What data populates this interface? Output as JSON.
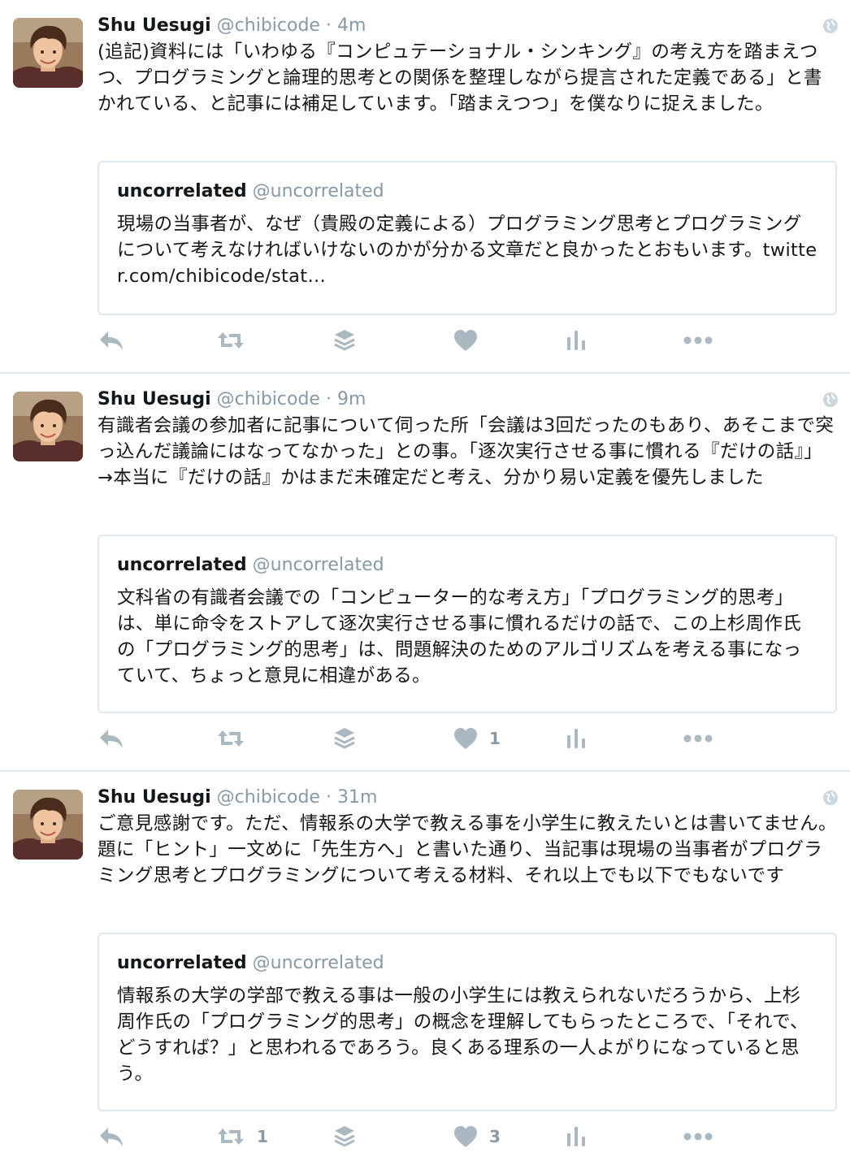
{
  "tweets": [
    {
      "name": "Shu Uesugi",
      "handle": "@chibicode",
      "dot": "·",
      "time": "4m",
      "text": "(追記)資料には「いわゆる『コンピュテーショナル・シンキング』の考え方を踏まえつつ、プログラミングと論理的思考との関係を整理しながら提言された定義である」と書かれている、と記事には補足しています。「踏まえつつ」を僕なりに捉えました。",
      "quote": {
        "name": "uncorrelated",
        "handle": "@uncorrelated",
        "text": "現場の当事者が、なぜ（貴殿の定義による）プログラミング思考とプログラミングについて考えなければいけないのかが分かる文章だと良かったとおもいます。twitter.com/chibicode/stat…"
      },
      "counts": {
        "retweets": "",
        "likes": ""
      }
    },
    {
      "name": "Shu Uesugi",
      "handle": "@chibicode",
      "dot": "·",
      "time": "9m",
      "text": "有識者会議の参加者に記事について伺った所「会議は3回だったのもあり、あそこまで突っ込んだ議論にはなってなかった」との事。「逐次実行させる事に慣れる『だけの話』」→本当に『だけの話』かはまだ未確定だと考え、分かり易い定義を優先しました",
      "quote": {
        "name": "uncorrelated",
        "handle": "@uncorrelated",
        "text": "文科省の有識者会議での「コンピューター的な考え方」「プログラミング的思考」は、単に命令をストアして逐次実行させる事に慣れるだけの話で、この上杉周作氏の「プログラミング的思考」は、問題解決のためのアルゴリズムを考える事になっていて、ちょっと意見に相違がある。"
      },
      "counts": {
        "retweets": "",
        "likes": "1"
      }
    },
    {
      "name": "Shu Uesugi",
      "handle": "@chibicode",
      "dot": "·",
      "time": "31m",
      "text": "ご意見感謝です。ただ、情報系の大学で教える事を小学生に教えたいとは書いてません。題に「ヒント」一文めに「先生方へ」と書いた通り、当記事は現場の当事者がプログラミング思考とプログラミングについて考える材料、それ以上でも以下でもないです",
      "quote": {
        "name": "uncorrelated",
        "handle": "@uncorrelated",
        "text": "情報系の大学の学部で教える事は一般の小学生には教えられないだろうから、上杉周作氏の「プログラミング的思考」の概念を理解してもらったところで、「それで、どうすれば？」と思われるであろう。良くある理系の一人よがりになっていると思う。"
      },
      "counts": {
        "retweets": "1",
        "likes": "3"
      }
    }
  ],
  "icons": {
    "avatar": "avatar-photo",
    "globe": "globe-icon",
    "reply": "reply-icon",
    "retweet": "retweet-icon",
    "stack": "stack-icon",
    "like": "heart-icon",
    "analytics": "analytics-icon",
    "more": "more-icon"
  },
  "colors": {
    "text": "#14171a",
    "muted": "#8899a6",
    "action_icon": "#aab8c2",
    "border": "#e1e8ed"
  }
}
